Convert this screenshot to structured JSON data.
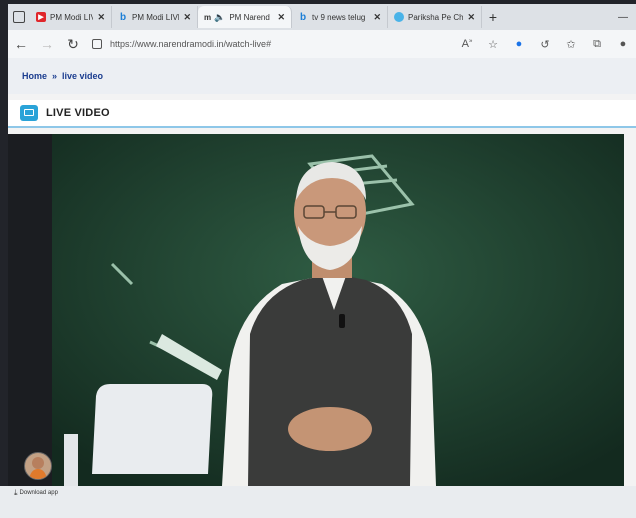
{
  "browser": {
    "tabs": [
      {
        "label": "PM Modi LIVE |",
        "icon": "youtube-icon",
        "active": false
      },
      {
        "label": "PM Modi LIVE |",
        "icon": "bing-icon",
        "active": false
      },
      {
        "label": "PM Narend",
        "icon": "speaker-icon",
        "prefix": "m",
        "active": true
      },
      {
        "label": "tv 9 news telug",
        "icon": "bing-icon",
        "active": false
      },
      {
        "label": "Pariksha Pe Cha",
        "icon": "globe-icon",
        "active": false
      }
    ],
    "new_tab": "+",
    "url": "https://www.narendramodi.in/watch-live#"
  },
  "page": {
    "breadcrumb": {
      "home": "Home",
      "separator": "»",
      "current": "live video"
    },
    "section_title": "LIVE VIDEO",
    "download_link": "Download app"
  },
  "colors": {
    "breadcrumb_text": "#1b3d8f",
    "accent": "#2aa3d8",
    "video_bg": "#1f3a2c"
  }
}
